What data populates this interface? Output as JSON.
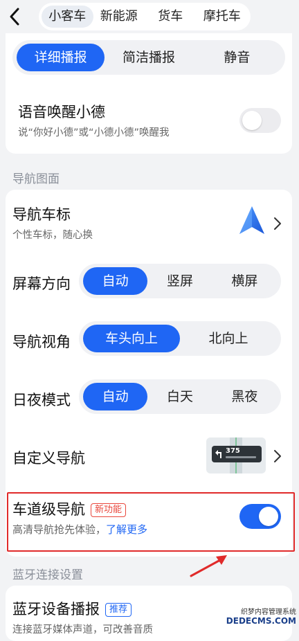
{
  "header": {
    "back_icon": "chevron-left-icon",
    "tabs": [
      {
        "label": "小客车",
        "active": true
      },
      {
        "label": "新能源",
        "active": false
      },
      {
        "label": "货车",
        "active": false
      },
      {
        "label": "摩托车",
        "active": false
      }
    ]
  },
  "voice": {
    "broadcast_modes": [
      "详细播报",
      "简洁播报",
      "静音"
    ],
    "selected": "详细播报",
    "wake": {
      "title": "语音唤醒小德",
      "subtitle": "说“你好小德”或“小德小德”唤醒我",
      "enabled": false
    }
  },
  "nav_display": {
    "section_label": "导航图面",
    "car_icon": {
      "title": "导航车标",
      "subtitle": "个性车标，随心换"
    },
    "screen_orientation": {
      "label": "屏幕方向",
      "options": [
        "自动",
        "竖屏",
        "横屏"
      ],
      "selected": "自动"
    },
    "view_angle": {
      "label": "导航视角",
      "options": [
        "车头向上",
        "北向上"
      ],
      "selected": "车头向上"
    },
    "day_night": {
      "label": "日夜模式",
      "options": [
        "自动",
        "白天",
        "黑夜"
      ],
      "selected": "自动"
    },
    "custom_nav": {
      "title": "自定义导航",
      "preview_distance": "375"
    },
    "lane_nav": {
      "title": "车道级导航",
      "badge": "新功能",
      "subtitle": "高清导航抢先体验，",
      "link": "了解更多",
      "enabled": true
    }
  },
  "bluetooth": {
    "section_label": "蓝牙连接设置",
    "device_broadcast": {
      "title": "蓝牙设备播报",
      "badge": "推荐",
      "subtitle": "连接蓝牙媒体声道，可改善音质"
    }
  },
  "watermark": {
    "line1": "织梦内容管理系统",
    "line2": "DEDECMS.COM"
  },
  "colors": {
    "accent": "#1f66f4",
    "highlight_border": "#e02a2a",
    "new_badge": "#e9463b",
    "background": "#f2f3f5"
  }
}
